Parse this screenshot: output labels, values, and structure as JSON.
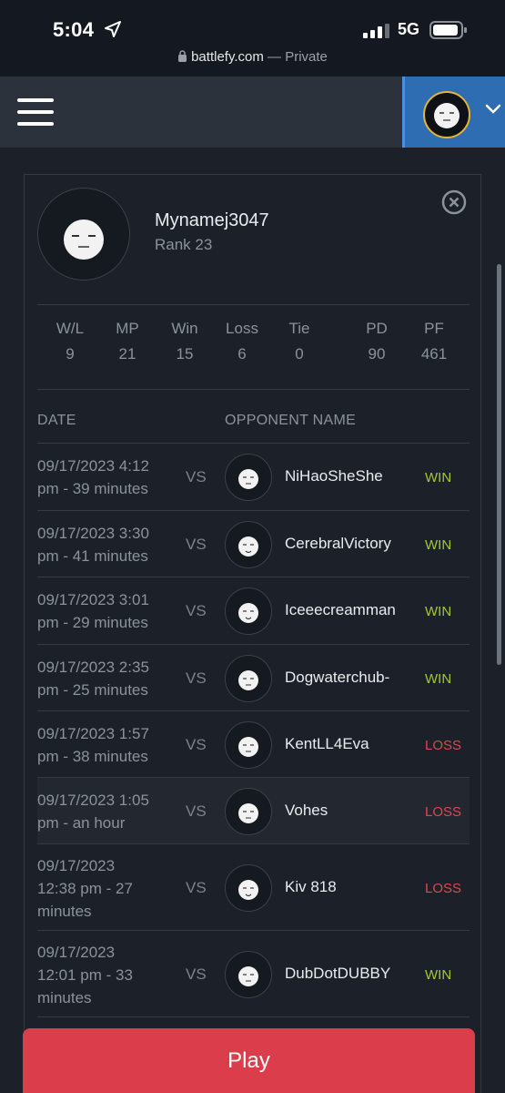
{
  "status_bar": {
    "time": "5:04",
    "network": "5G",
    "url": "battlefy.com",
    "url_suffix": "— Private"
  },
  "header": {
    "menu_icon": "hamburger-icon",
    "chevron_icon": "chevron-down-icon",
    "accent_color": "#2f6db3"
  },
  "profile": {
    "username": "Mynamej3047",
    "rank": "Rank 23"
  },
  "stats": [
    {
      "label": "W/L",
      "value": "9"
    },
    {
      "label": "MP",
      "value": "21"
    },
    {
      "label": "Win",
      "value": "15"
    },
    {
      "label": "Loss",
      "value": "6"
    },
    {
      "label": "Tie",
      "value": "0"
    },
    {
      "label": "PD",
      "value": "90"
    },
    {
      "label": "PF",
      "value": "461"
    }
  ],
  "columns": {
    "date": "DATE",
    "opponent": "OPPONENT NAME"
  },
  "matches": [
    {
      "date_line1": "09/17/2023 4:12",
      "date_line2": "pm - 39 minutes",
      "date_line3": "",
      "vs": "VS",
      "opponent": "NiHaoSheShe",
      "result": "WIN"
    },
    {
      "date_line1": "09/17/2023 3:30",
      "date_line2": "pm - 41 minutes",
      "date_line3": "",
      "vs": "VS",
      "opponent": "CerebralVictory",
      "result": "WIN"
    },
    {
      "date_line1": "09/17/2023 3:01",
      "date_line2": "pm - 29 minutes",
      "date_line3": "",
      "vs": "VS",
      "opponent": "Iceeecreamman",
      "result": "WIN"
    },
    {
      "date_line1": "09/17/2023 2:35",
      "date_line2": "pm - 25 minutes",
      "date_line3": "",
      "vs": "VS",
      "opponent": "Dogwaterchub-",
      "result": "WIN"
    },
    {
      "date_line1": "09/17/2023 1:57",
      "date_line2": "pm - 38 minutes",
      "date_line3": "",
      "vs": "VS",
      "opponent": "KentLL4Eva",
      "result": "LOSS"
    },
    {
      "date_line1": "09/17/2023 1:05",
      "date_line2": "pm - an hour",
      "date_line3": "",
      "vs": "VS",
      "opponent": "Vohes",
      "result": "LOSS"
    },
    {
      "date_line1": "09/17/2023",
      "date_line2": "12:38 pm - 27",
      "date_line3": "minutes",
      "vs": "VS",
      "opponent": "Kiv 818",
      "result": "LOSS"
    },
    {
      "date_line1": "09/17/2023",
      "date_line2": "12:01 pm - 33",
      "date_line3": "minutes",
      "vs": "VS",
      "opponent": "DubDotDUBBY",
      "result": "WIN"
    }
  ],
  "play_button": "Play",
  "colors": {
    "win": "#a4c639",
    "loss": "#e0454f",
    "play": "#dc3d4b"
  }
}
